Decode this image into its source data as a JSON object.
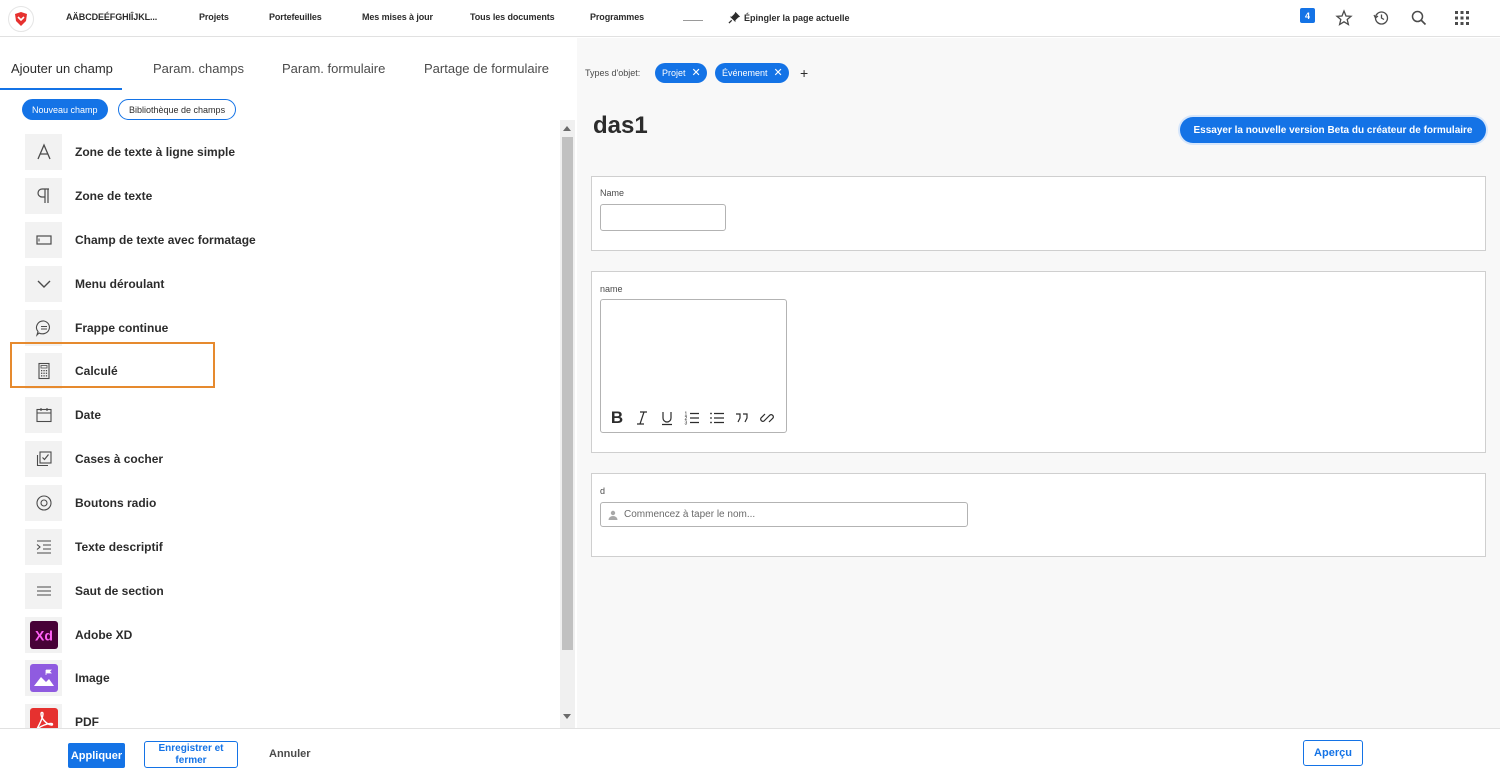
{
  "topnav": {
    "app_label": "AÄBCDEÉFGHIÎJKL...",
    "items": [
      "Projets",
      "Portefeuilles",
      "Mes mises à jour",
      "Tous les documents",
      "Programmes"
    ],
    "pin_label": "Épingler la page actuelle",
    "notification_count": "4",
    "icons": [
      "logo-icon",
      "pin-icon",
      "star-icon",
      "history-icon",
      "search-icon",
      "apps-grid-icon"
    ]
  },
  "left_panel": {
    "tabs": [
      "Ajouter un champ",
      "Param. champs",
      "Param. formulaire",
      "Partage de formulaire"
    ],
    "active_tab": "Ajouter un champ",
    "new_field_button": "Nouveau champ",
    "library_button": "Bibliothèque de champs",
    "fields": [
      {
        "label": "Zone de texte à ligne simple",
        "icon": "letter-a-icon"
      },
      {
        "label": "Zone de texte",
        "icon": "paragraph-icon"
      },
      {
        "label": "Champ de texte avec formatage",
        "icon": "rectangle-icon"
      },
      {
        "label": "Menu déroulant",
        "icon": "chevron-down-icon"
      },
      {
        "label": "Frappe continue",
        "icon": "speech-bubble-icon"
      },
      {
        "label": "Calculé",
        "icon": "calculator-icon"
      },
      {
        "label": "Date",
        "icon": "calendar-icon"
      },
      {
        "label": "Cases à cocher",
        "icon": "checkbox-icon"
      },
      {
        "label": "Boutons radio",
        "icon": "radio-icon"
      },
      {
        "label": "Texte descriptif",
        "icon": "text-indent-icon"
      },
      {
        "label": "Saut de section",
        "icon": "section-break-icon"
      },
      {
        "label": "Adobe XD",
        "icon": "adobe-xd-icon"
      },
      {
        "label": "Image",
        "icon": "image-icon"
      },
      {
        "label": "PDF",
        "icon": "pdf-icon"
      }
    ],
    "highlighted_field": "Frappe continue"
  },
  "right_panel": {
    "object_types_label": "Types d'objet:",
    "object_types": [
      "Projet",
      "Événement"
    ],
    "add_symbol": "+",
    "form_title": "das1",
    "beta_button": "Essayer la nouvelle version Beta du créateur de formulaire",
    "cards": [
      {
        "label": "Name",
        "type": "text"
      },
      {
        "label": "name",
        "type": "rich-text"
      },
      {
        "label": "d",
        "type": "typeahead",
        "placeholder": "Commencez à taper le nom..."
      }
    ]
  },
  "bottom_bar": {
    "apply": "Appliquer",
    "save_close": "Enregistrer et fermer",
    "cancel": "Annuler",
    "preview": "Aperçu"
  },
  "colors": {
    "accent": "#1473e6",
    "highlight": "#e68a2e",
    "xd_bg": "#470137",
    "xd_fg": "#ff61f6",
    "image_bg": "#8f5be0",
    "pdf_bg": "#e6312f"
  }
}
